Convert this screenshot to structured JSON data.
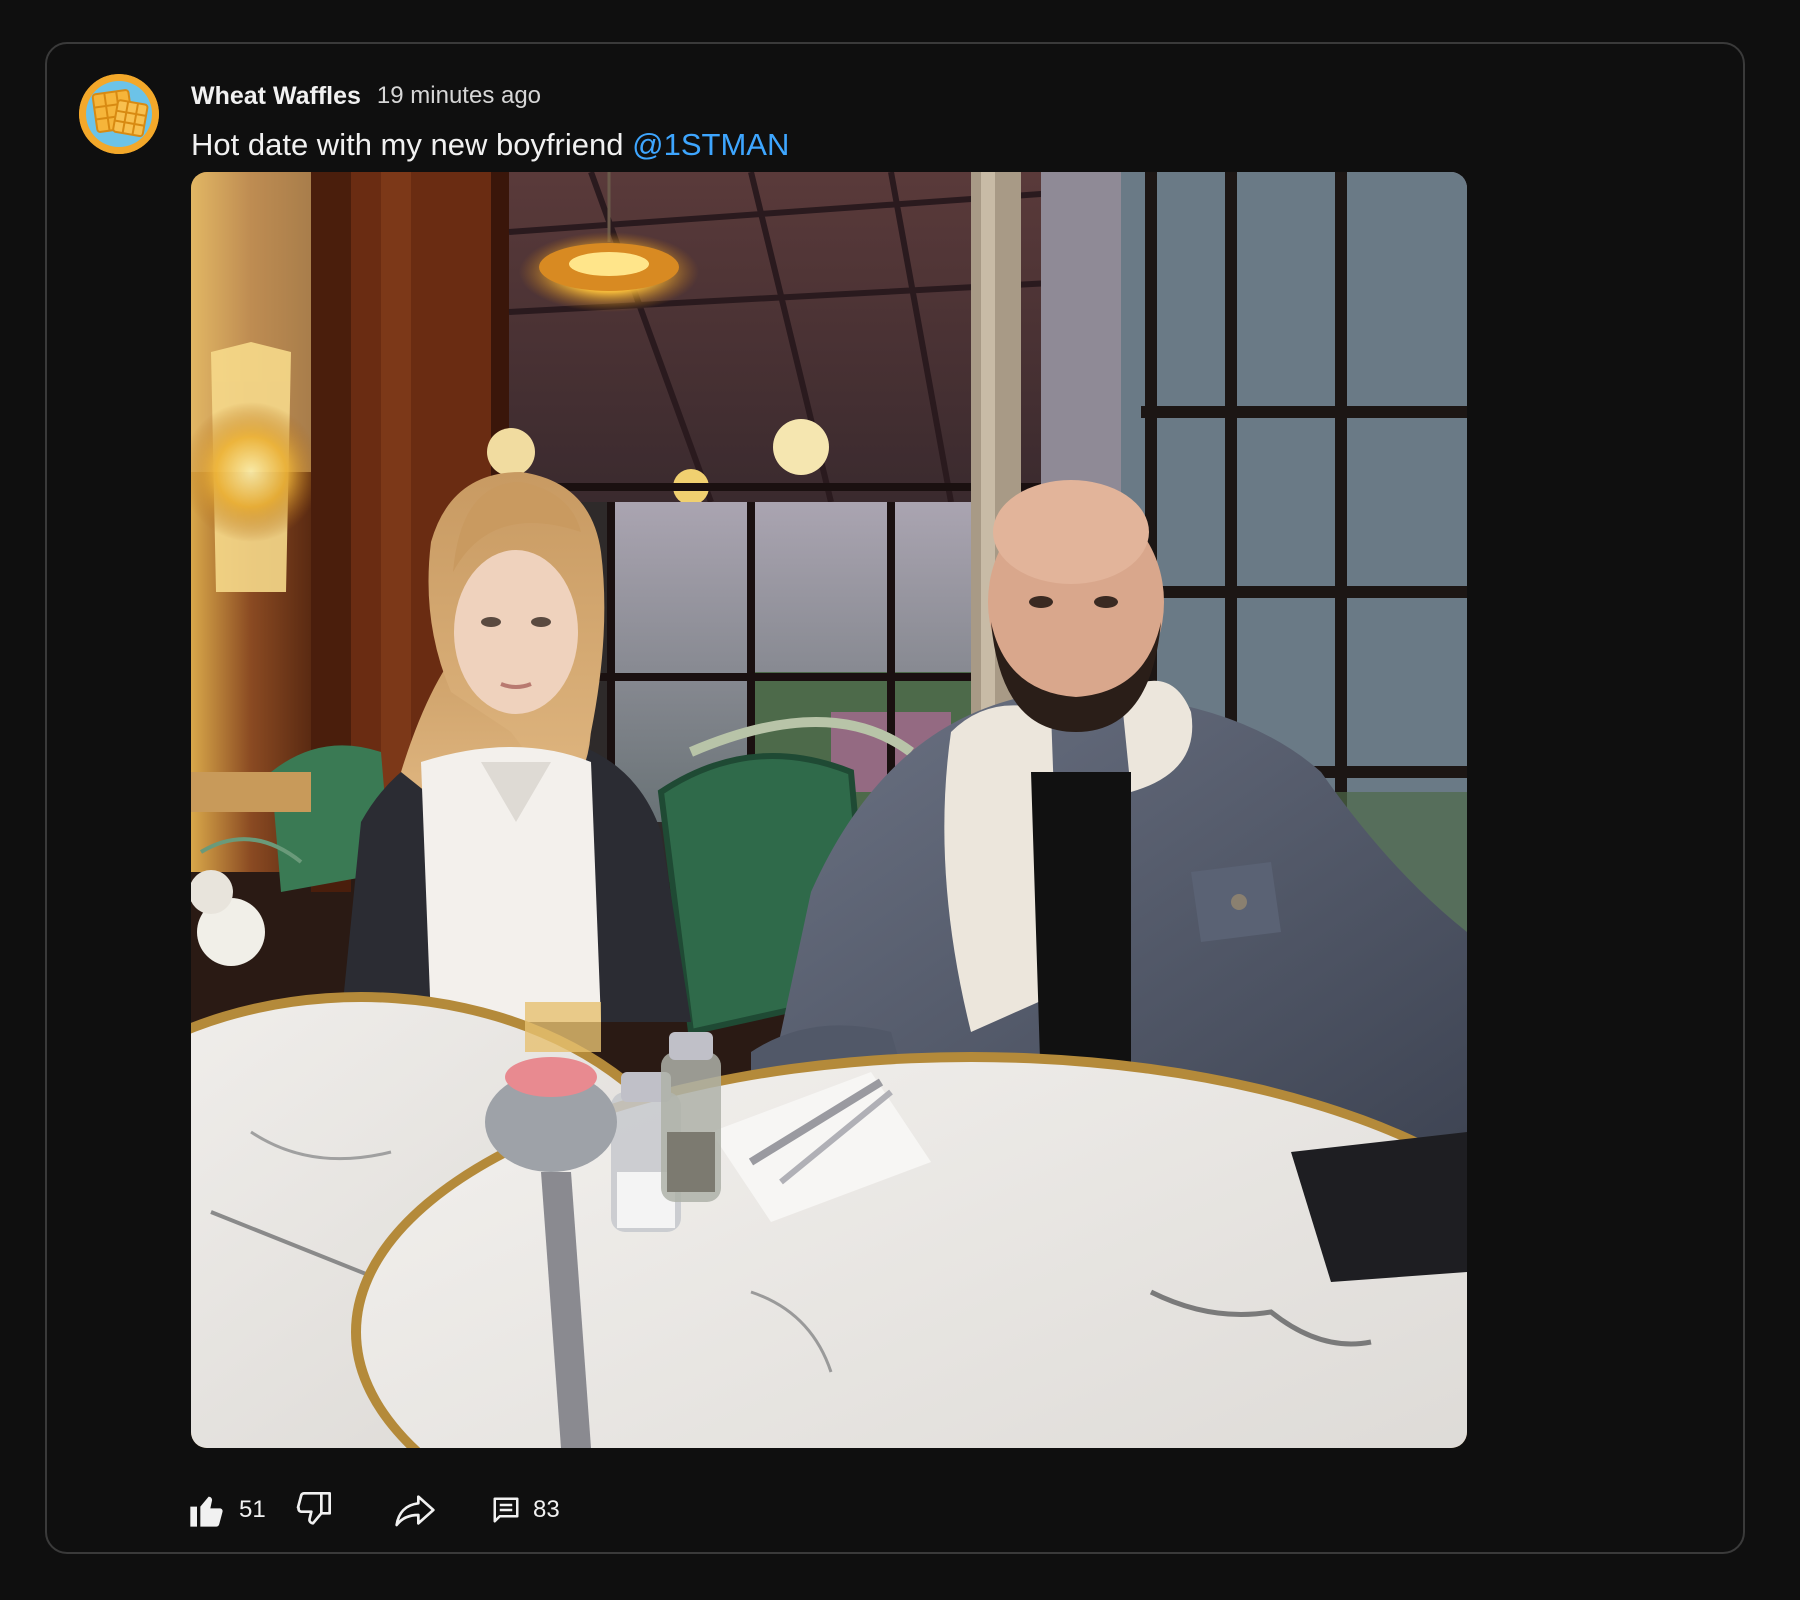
{
  "post": {
    "author": "Wheat Waffles",
    "timestamp": "19 minutes ago",
    "text": "Hot date with my new boyfriend",
    "mention": "@1STMAN",
    "image_alt": "Hot date with my new boyfriend @1STMAN"
  },
  "actions": {
    "like_count": "51",
    "comment_count": "83"
  },
  "icons": {
    "avatar": "waffle-icon",
    "like": "thumbs-up-icon",
    "dislike": "thumbs-down-icon",
    "share": "share-arrow-icon",
    "comment": "comment-icon"
  },
  "colors": {
    "background": "#0f0f0f",
    "card_border": "#3a3a3a",
    "mention": "#3ea6ff",
    "avatar": "#f3a82a"
  }
}
